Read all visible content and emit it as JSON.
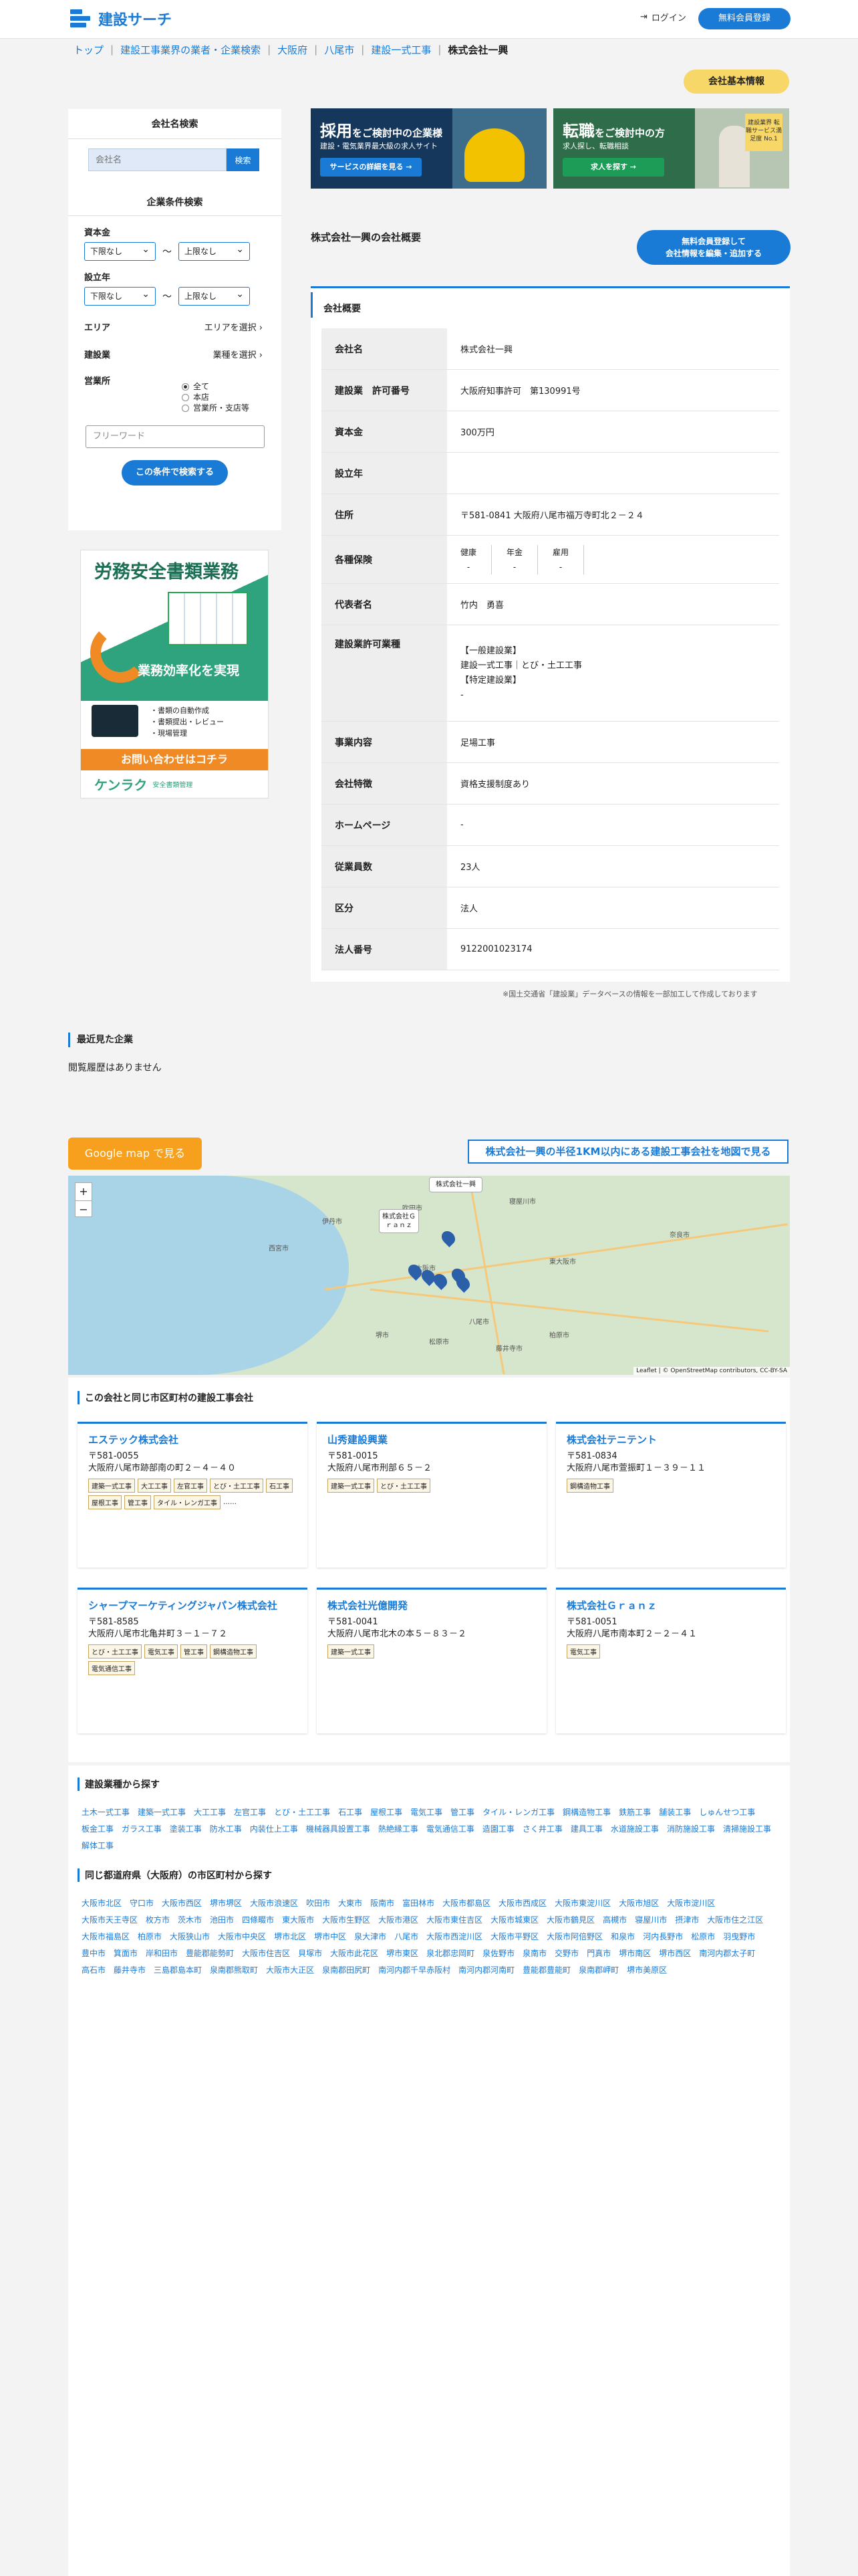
{
  "header": {
    "logo": "建設サーチ",
    "login": "ログイン",
    "register": "無料会員登録"
  },
  "breadcrumb": [
    "トップ",
    "建設工事業界の業者・企業検索",
    "大阪府",
    "八尾市",
    "建設一式工事",
    "株式会社一興"
  ],
  "basic_info_button": "会社基本情報",
  "sidebar": {
    "search_title": "会社名検索",
    "search_placeholder": "会社名",
    "search_button": "検索",
    "cond_title": "企業条件検索",
    "capital_label": "資本金",
    "capital_from": "下限なし",
    "capital_to": "上限なし",
    "tilde": "〜",
    "founded_label": "設立年",
    "founded_from": "下限なし",
    "founded_to": "上限なし",
    "area_label": "エリア",
    "area_value": "エリアを選択",
    "industry_label": "建設業",
    "industry_value": "業種を選択",
    "office_label": "営業所",
    "office_options": [
      "全て",
      "本店",
      "営業所・支店等"
    ],
    "freeword_placeholder": "フリーワード",
    "submit": "この条件で検索する"
  },
  "banner": {
    "title": "労務安全書類業務",
    "subtitle": "業務効率化を実現",
    "bullets": [
      "・書類の自動作成",
      "・書類提出・レビュー",
      "・現場管理"
    ],
    "cta": "お問い合わせはコチラ",
    "brand": "ケンラク",
    "brand_sub": "安全書類管理"
  },
  "ads": [
    {
      "head1": "採用",
      "head2": "をご検討中の企業様",
      "sub": "建設・電気業界最大級の求人サイト",
      "button": "サービスの詳細を見る →"
    },
    {
      "head1": "転職",
      "head2": "をご検討中の方",
      "sub": "求人探し、転職相談",
      "button": "求人を探す →",
      "badge": "建設業界 転職サービス満足度 No.1"
    }
  ],
  "overview_title": "株式会社一興の会社概要",
  "edit_button": [
    "無料会員登録して",
    "会社情報を編集・追加する"
  ],
  "panel_title": "会社概要",
  "profile": [
    {
      "k": "会社名",
      "v": "株式会社一興"
    },
    {
      "k": "建設業　許可番号",
      "v": "大阪府知事許可　第130991号"
    },
    {
      "k": "資本金",
      "v": "300万円"
    },
    {
      "k": "設立年",
      "v": ""
    },
    {
      "k": "住所",
      "v": "〒581-0841 大阪府八尾市福万寺町北２－２４"
    },
    {
      "k": "各種保険",
      "v": ""
    },
    {
      "k": "代表者名",
      "v": "竹内　勇喜"
    },
    {
      "k": "建設業許可業種",
      "v": ""
    },
    {
      "k": "事業内容",
      "v": "足場工事"
    },
    {
      "k": "会社特徴",
      "v": "資格支援制度あり"
    },
    {
      "k": "ホームページ",
      "v": "-"
    },
    {
      "k": "従業員数",
      "v": "23人"
    },
    {
      "k": "区分",
      "v": "法人"
    },
    {
      "k": "法人番号",
      "v": "9122001023174"
    }
  ],
  "insurance": [
    {
      "name": "健康",
      "val": "-"
    },
    {
      "name": "年金",
      "val": "-"
    },
    {
      "name": "雇用",
      "val": "-"
    }
  ],
  "permits": [
    "【一般建設業】",
    "建設一式工事｜とび・土工工事",
    "【特定建設業】",
    "-"
  ],
  "source_note": "※国土交通省「建設業」データベースの情報を一部加工して作成しております",
  "recent": {
    "title": "最近見た企業",
    "empty": "閲覧履歴はありません"
  },
  "map": {
    "google_button": "Google map で見る",
    "near_button": "株式会社一興の半径1KM以内にある建設工事会社を地図で見る",
    "popup1": "株式会社一興",
    "popup2": "株式会社Ｇｒａｎｚ",
    "attribution": "Leaflet | © OpenStreetMap contributors, CC-BY-SA",
    "zoom_in": "+",
    "zoom_out": "−",
    "cities": [
      "大阪市",
      "八尾市",
      "東大阪市",
      "堺市",
      "松原市",
      "藤井寺市",
      "柏原市",
      "奈良市",
      "吹田市",
      "寝屋川市",
      "伊丹市",
      "西宮市"
    ]
  },
  "same_title": "この会社と同じ市区町村の建設工事会社",
  "cards": [
    {
      "name": "エステック株式会社",
      "zip": "〒581-0055",
      "addr": "大阪府八尾市跡部南の町２－４－４０",
      "tags": [
        "建築一式工事",
        "大工工事",
        "左官工事",
        "とび・土工工事",
        "石工事",
        "屋根工事",
        "管工事",
        "タイル・レンガ工事"
      ],
      "more": "……"
    },
    {
      "name": "山秀建設興業",
      "zip": "〒581-0015",
      "addr": "大阪府八尾市刑部６５－２",
      "tags": [
        "建築一式工事",
        "とび・土工工事"
      ],
      "more": ""
    },
    {
      "name": "株式会社テニテント",
      "zip": "〒581-0834",
      "addr": "大阪府八尾市萱振町１－３９－１１",
      "tags": [
        "鋼構造物工事"
      ],
      "more": ""
    },
    {
      "name": "シャープマーケティングジャパン株式会社",
      "zip": "〒581-8585",
      "addr": "大阪府八尾市北亀井町３－１－７２",
      "tags": [
        "とび・土工工事",
        "電気工事",
        "管工事",
        "鋼構造物工事",
        "電気通信工事"
      ],
      "more": ""
    },
    {
      "name": "株式会社光億開発",
      "zip": "〒581-0041",
      "addr": "大阪府八尾市北木の本５－８３－２",
      "tags": [
        "建築一式工事"
      ],
      "more": ""
    },
    {
      "name": "株式会社Ｇｒａｎｚ",
      "zip": "〒581-0051",
      "addr": "大阪府八尾市南本町２－２－４１",
      "tags": [
        "電気工事"
      ],
      "more": ""
    }
  ],
  "types_title": "建設業種から探す",
  "types": [
    "土木一式工事",
    "建築一式工事",
    "大工工事",
    "左官工事",
    "とび・土工工事",
    "石工事",
    "屋根工事",
    "電気工事",
    "管工事",
    "タイル・レンガ工事",
    "鋼構造物工事",
    "鉄筋工事",
    "舗装工事",
    "しゅんせつ工事",
    "板金工事",
    "ガラス工事",
    "塗装工事",
    "防水工事",
    "内装仕上工事",
    "機械器具設置工事",
    "熱絶縁工事",
    "電気通信工事",
    "造園工事",
    "さく井工事",
    "建具工事",
    "水道施設工事",
    "消防施設工事",
    "清掃施設工事",
    "解体工事"
  ],
  "cities_title": "同じ都道府県（大阪府）の市区町村から探す",
  "cities": [
    "大阪市北区",
    "守口市",
    "大阪市西区",
    "堺市堺区",
    "大阪市浪速区",
    "吹田市",
    "大東市",
    "阪南市",
    "富田林市",
    "大阪市都島区",
    "大阪市西成区",
    "大阪市東淀川区",
    "大阪市旭区",
    "大阪市淀川区",
    "大阪市天王寺区",
    "枚方市",
    "茨木市",
    "池田市",
    "四條畷市",
    "東大阪市",
    "大阪市生野区",
    "大阪市港区",
    "大阪市東住吉区",
    "大阪市城東区",
    "大阪市鶴見区",
    "高槻市",
    "寝屋川市",
    "摂津市",
    "大阪市住之江区",
    "大阪市福島区",
    "柏原市",
    "大阪狭山市",
    "大阪市中央区",
    "堺市北区",
    "堺市中区",
    "泉大津市",
    "八尾市",
    "大阪市西淀川区",
    "大阪市平野区",
    "大阪市阿倍野区",
    "和泉市",
    "河内長野市",
    "松原市",
    "羽曳野市",
    "豊中市",
    "箕面市",
    "岸和田市",
    "豊能郡能勢町",
    "大阪市住吉区",
    "貝塚市",
    "大阪市此花区",
    "堺市東区",
    "泉北郡忠岡町",
    "泉佐野市",
    "泉南市",
    "交野市",
    "門真市",
    "堺市南区",
    "堺市西区",
    "南河内郡太子町",
    "高石市",
    "藤井寺市",
    "三島郡島本町",
    "泉南郡熊取町",
    "大阪市大正区",
    "泉南郡田尻町",
    "南河内郡千早赤阪村",
    "南河内郡河南町",
    "豊能郡豊能町",
    "泉南郡岬町",
    "堺市美原区"
  ],
  "city_note": ""
}
